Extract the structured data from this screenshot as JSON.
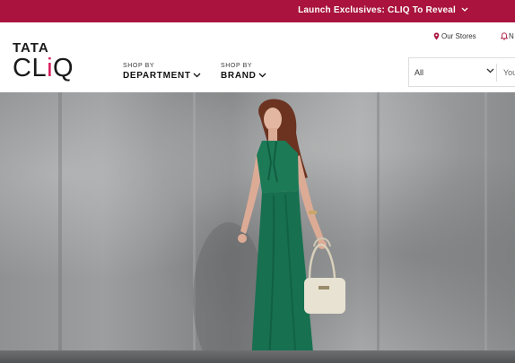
{
  "topbar": {
    "promo": "Launch Exclusives: CLIQ To Reveal"
  },
  "logo": {
    "line1": "TATA",
    "line2_pre": "CL",
    "line2_i": "i",
    "line2_post": "Q"
  },
  "nav": [
    {
      "small": "SHOP BY",
      "big": "DEPARTMENT"
    },
    {
      "small": "SHOP BY",
      "big": "BRAND"
    }
  ],
  "header_links": {
    "stores": "Our Stores",
    "notifications": "N"
  },
  "search": {
    "category": "All",
    "placeholder": "You"
  },
  "colors": {
    "brand": "#a9133d",
    "accent": "#da1c5c",
    "dress": "#1a7a55"
  },
  "hero": {
    "image": "woman in green dress with white handbag against concrete wall"
  }
}
